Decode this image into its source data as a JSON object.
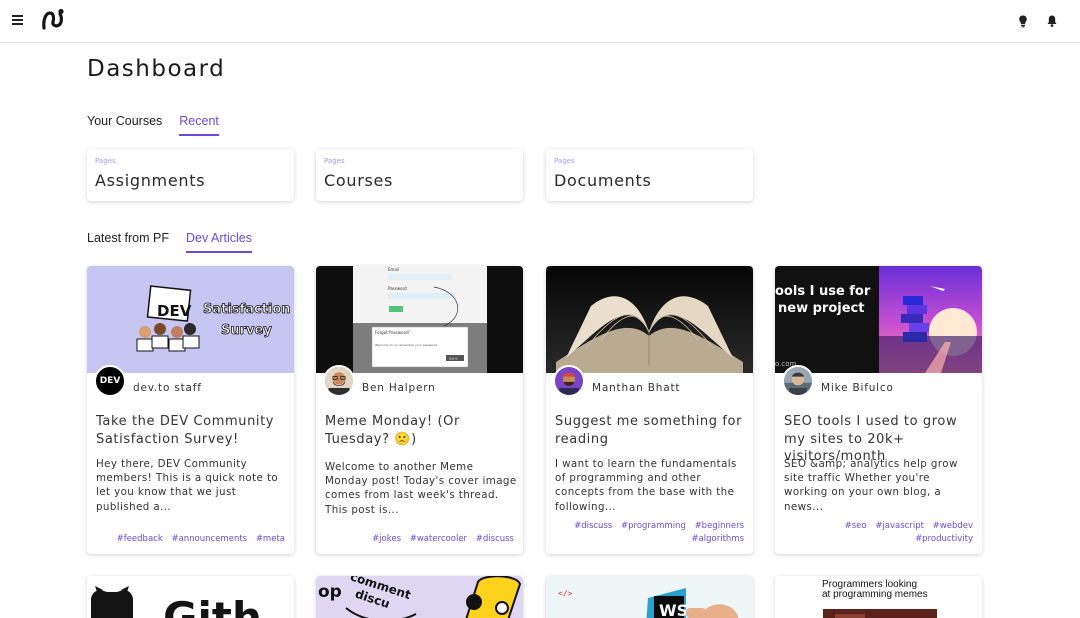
{
  "header": {
    "menu_icon": "hamburger-menu-icon",
    "logo_icon": "app-logo-icon",
    "right_icons": [
      "lightbulb-icon",
      "bell-icon"
    ]
  },
  "page_title": "Dashboard",
  "course_tabs": [
    {
      "label": "Your Courses",
      "active": false
    },
    {
      "label": "Recent",
      "active": true
    }
  ],
  "recent_pages": [
    {
      "kicker": "Pages",
      "name": "Assignments"
    },
    {
      "kicker": "Pages",
      "name": "Courses"
    },
    {
      "kicker": "Pages",
      "name": "Documents"
    }
  ],
  "article_tabs": [
    {
      "label": "Latest from PF",
      "active": false
    },
    {
      "label": "Dev Articles",
      "active": true
    }
  ],
  "articles": [
    {
      "author": "dev.to staff",
      "title": "Take the DEV Community Satisfaction Survey!",
      "description": "Hey there, DEV Community members! This is a quick note to let you know that we just published a...",
      "tags": [
        "#feedback",
        "#announcements",
        "#meta"
      ],
      "cover_text": [
        "DEV",
        "Satisfaction",
        "Survey"
      ],
      "avatar_text": "DEV"
    },
    {
      "author": "Ben Halpern",
      "title": "Meme Monday! (Or Tuesday? 🙁)",
      "description": "Welcome to another Meme Monday post! Today's cover image comes from last week's thread. This post is...",
      "tags": [
        "#jokes",
        "#watercooler",
        "#discuss"
      ],
      "cover_text": [
        "Email",
        "Password",
        "Forgot Password?",
        "Welcome to no remember your password.",
        "Got it"
      ]
    },
    {
      "author": "Manthan Bhatt",
      "title": "Suggest me something for reading",
      "description": "I want to learn the fundamentals of programming and other concepts from the base with the following...",
      "tags": [
        "#discuss",
        "#programming",
        "#beginners",
        "#algorithms"
      ]
    },
    {
      "author": "Mike Bifulco",
      "title": "SEO tools I used to grow my sites to 20k+ visitors/month",
      "description": "SEO &amp; analytics help grow site traffic Whether you're working on your own blog, a news...",
      "tags": [
        "#seo",
        "#javascript",
        "#webdev",
        "#productivity"
      ],
      "cover_text": [
        "ools I use for",
        "new project",
        "o.com"
      ]
    }
  ],
  "bottom_cards": [
    {
      "cover_text": "Gith"
    },
    {
      "cover_text": [
        "op",
        "comment",
        "discu"
      ]
    },
    {
      "cover_text": "WS"
    },
    {
      "cover_text": [
        "Programmers looking",
        "at programming memes"
      ]
    }
  ],
  "colors": {
    "accent": "#6a4ad6",
    "tag": "#6a4ad6",
    "kicker": "#a79be4",
    "divider": "#e4e4e4"
  }
}
